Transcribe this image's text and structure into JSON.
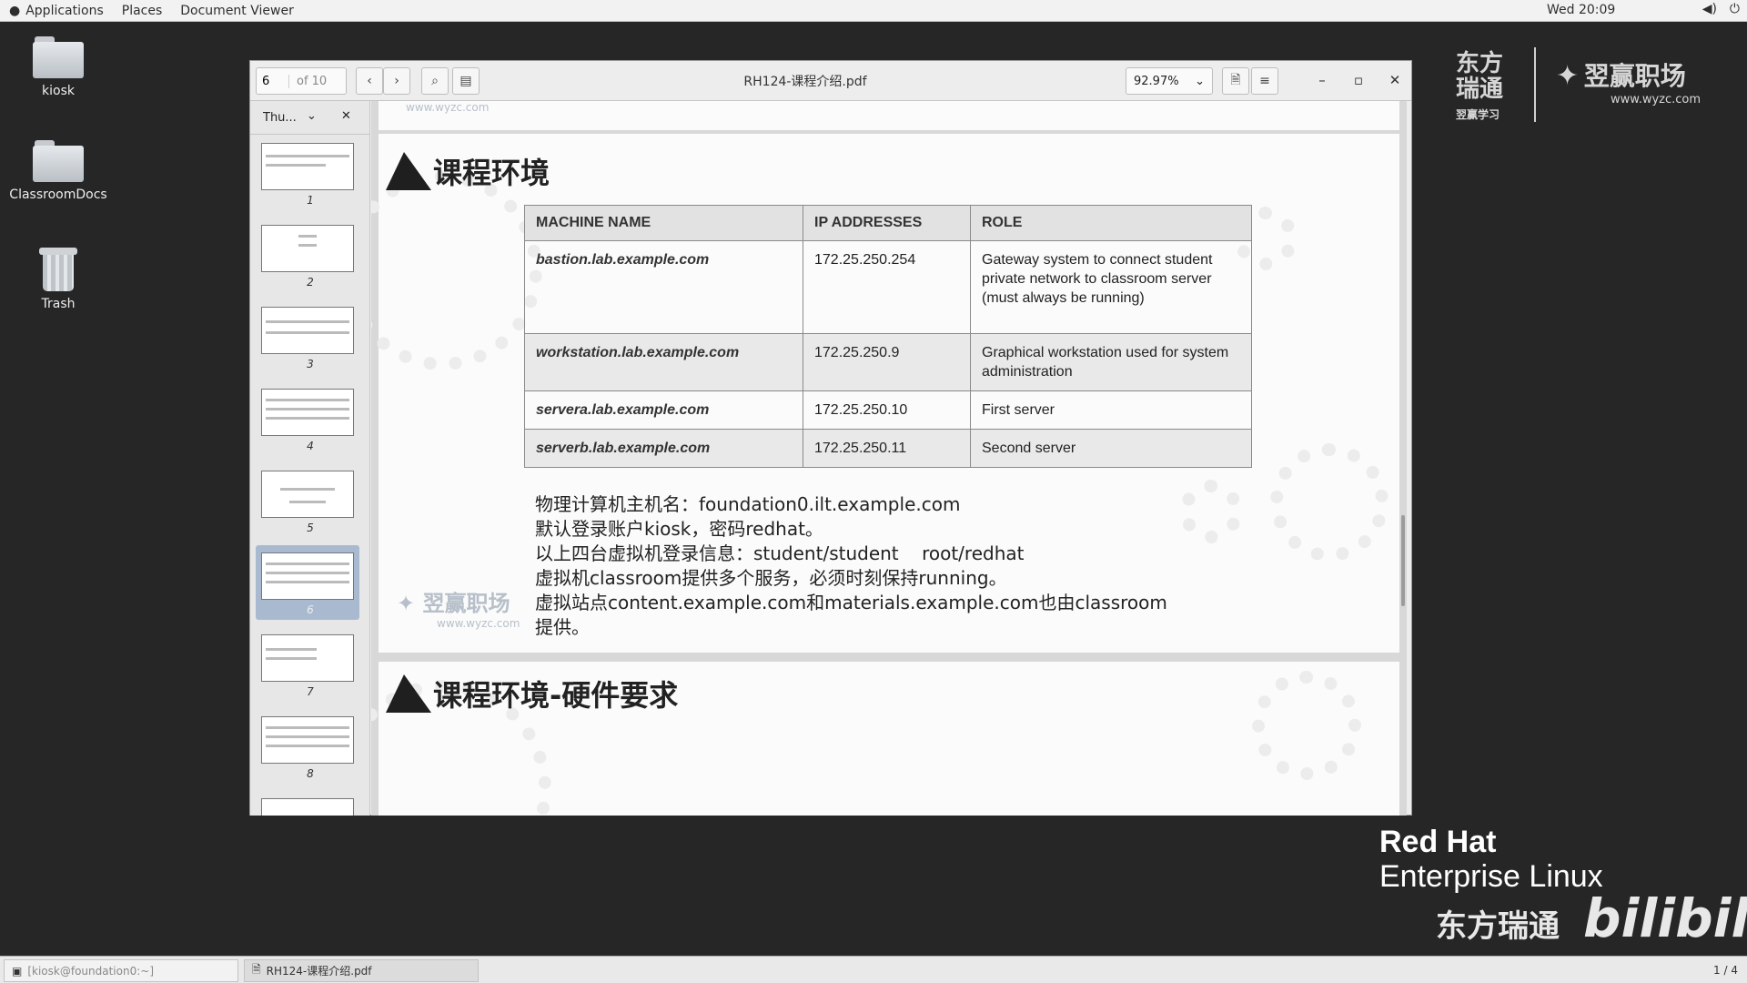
{
  "topbar": {
    "applications": "Applications",
    "places": "Places",
    "document_viewer": "Document Viewer",
    "clock": "Wed 20:09"
  },
  "desktop": {
    "icons": [
      {
        "label": "kiosk"
      },
      {
        "label": "ClassroomDocs"
      },
      {
        "label": "Trash"
      }
    ]
  },
  "window": {
    "page_input": "6",
    "page_count": "of 10",
    "title": "RH124-课程介绍.pdf",
    "zoom": "92.97%",
    "sidebar_mode": "Thu...",
    "thumbnails": [
      "1",
      "2",
      "3",
      "4",
      "5",
      "6",
      "7",
      "8"
    ],
    "selected_page": "6"
  },
  "slide": {
    "watermark_top": "www.wyzc.com",
    "title": "课程环境",
    "table": {
      "headers": [
        "MACHINE NAME",
        "IP ADDRESSES",
        "ROLE"
      ],
      "rows": [
        [
          "bastion.lab.example.com",
          "172.25.250.254",
          "Gateway system to connect student private network to classroom server (must always be running)"
        ],
        [
          "workstation.lab.example.com",
          "172.25.250.9",
          "Graphical workstation used for system administration"
        ],
        [
          "servera.lab.example.com",
          "172.25.250.10",
          "First server"
        ],
        [
          "serverb.lab.example.com",
          "172.25.250.11",
          "Second server"
        ]
      ]
    },
    "notes": [
      "物理计算机主机名：foundation0.ilt.example.com",
      "默认登录账户kiosk，密码redhat。",
      "以上四台虚拟机登录信息：student/student    root/redhat",
      "虚拟机classroom提供多个服务，必须时刻保持running。",
      "虚拟站点content.example.com和materials.example.com也由classroom",
      "提供。"
    ],
    "watermark_bottom_cn": "翌赢职场",
    "watermark_bottom_url": "www.wyzc.com",
    "next_title": "课程环境-硬件要求"
  },
  "branding": {
    "dongfang_1": "东方",
    "dongfang_2": "瑞通",
    "dongfang_3": "翌赢学习",
    "wyzc_cn": "翌赢职场",
    "wyzc_url": "www.wyzc.com",
    "redhat_line1": "Red Hat",
    "redhat_line2": "Enterprise Linux",
    "dongfang_bottom": "东方瑞通",
    "bilibili": "bilibili"
  },
  "taskbar": {
    "terminal": "[kiosk@foundation0:~]",
    "document": "RH124-课程介绍.pdf",
    "workspace": "1 / 4"
  }
}
